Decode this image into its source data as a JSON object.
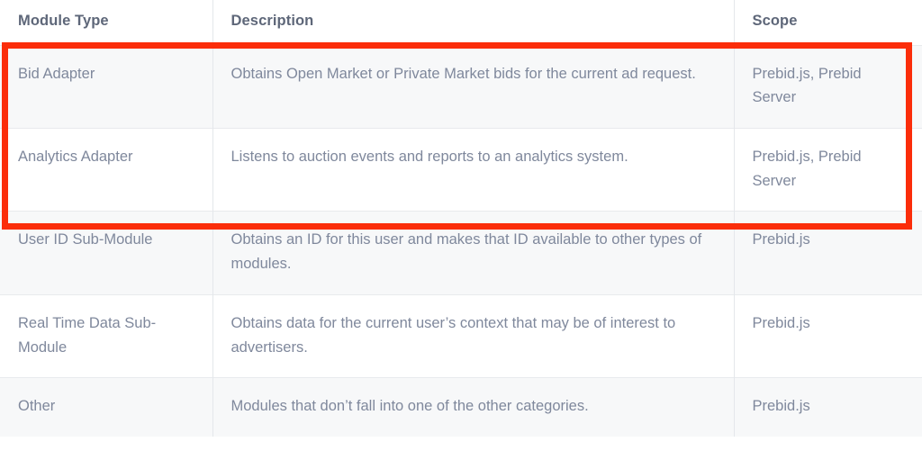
{
  "table": {
    "columns": [
      {
        "key": "module_type",
        "label": "Module Type"
      },
      {
        "key": "description",
        "label": "Description"
      },
      {
        "key": "scope",
        "label": "Scope"
      }
    ],
    "rows": [
      {
        "module_type": "Bid Adapter",
        "description": "Obtains Open Market or Private Market bids for the current ad request.",
        "scope": "Prebid.js, Prebid Server",
        "shade": "odd",
        "highlighted": true
      },
      {
        "module_type": "Analytics Adapter",
        "description": "Listens to auction events and reports to an analytics system.",
        "scope": "Prebid.js, Prebid Server",
        "shade": "even",
        "highlighted": true
      },
      {
        "module_type": "User ID Sub-Module",
        "description": "Obtains an ID for this user and makes that ID available to other types of modules.",
        "scope": "Prebid.js",
        "shade": "odd",
        "highlighted": false
      },
      {
        "module_type": "Real Time Data Sub-Module",
        "description": "Obtains data for the current user’s context that may be of interest to advertisers.",
        "scope": "Prebid.js",
        "shade": "even",
        "highlighted": false
      },
      {
        "module_type": "Other",
        "description": "Modules that don’t fall into one of the other categories.",
        "scope": "Prebid.js",
        "shade": "odd",
        "highlighted": false
      }
    ]
  },
  "annotation": {
    "type": "highlight-rectangle",
    "color": "#fb2d0a",
    "covers_rows": [
      "Bid Adapter",
      "Analytics Adapter"
    ]
  },
  "colors": {
    "header_text": "#5e6779",
    "body_text": "#7f889c",
    "row_shade": "#f7f8f9",
    "row_plain": "#ffffff",
    "cell_border": "#e4e7eb",
    "highlight": "#fb2d0a"
  }
}
